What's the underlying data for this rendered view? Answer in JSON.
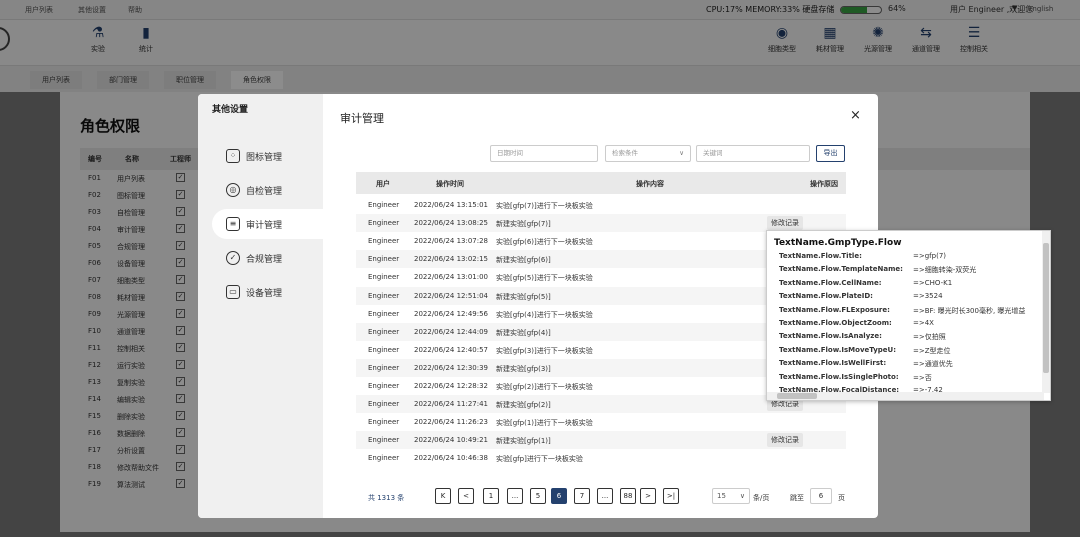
{
  "topbar": {
    "menu": [
      "用户列表",
      "其他设置",
      "帮助"
    ],
    "status": "CPU:17% MEMORY:33% 硬盘存储",
    "disk_fill": 0.64,
    "disk_pct": "64%",
    "user": "用户 Engineer ,欢迎您",
    "caret": "▼",
    "lang": "English"
  },
  "toolbar": {
    "left": [
      {
        "label": "实验",
        "icon": "flask-icon",
        "glyph": "⚗"
      },
      {
        "label": "统计",
        "icon": "bar-chart-icon",
        "glyph": "▮"
      }
    ],
    "right": [
      {
        "label": "细胞类型",
        "icon": "cell-icon",
        "glyph": "◉"
      },
      {
        "label": "耗材管理",
        "icon": "consumable-icon",
        "glyph": "▦"
      },
      {
        "label": "光源管理",
        "icon": "light-icon",
        "glyph": "✺"
      },
      {
        "label": "通道管理",
        "icon": "channel-icon",
        "glyph": "⇆"
      },
      {
        "label": "控制相关",
        "icon": "control-icon",
        "glyph": "☰"
      }
    ]
  },
  "bg_tabs": [
    "用户列表",
    "部门管理",
    "职位管理",
    "角色权限"
  ],
  "role": {
    "title": "角色权限",
    "headers": [
      "编号",
      "名称",
      "工程师"
    ],
    "rows": [
      {
        "id": "F01",
        "name": "用户列表"
      },
      {
        "id": "F02",
        "name": "图标管理"
      },
      {
        "id": "F03",
        "name": "自检管理"
      },
      {
        "id": "F04",
        "name": "审计管理"
      },
      {
        "id": "F05",
        "name": "合规管理"
      },
      {
        "id": "F06",
        "name": "设备管理"
      },
      {
        "id": "F07",
        "name": "细胞类型"
      },
      {
        "id": "F08",
        "name": "耗材管理"
      },
      {
        "id": "F09",
        "name": "光源管理"
      },
      {
        "id": "F10",
        "name": "通道管理"
      },
      {
        "id": "F11",
        "name": "控制相关"
      },
      {
        "id": "F12",
        "name": "运行实验"
      },
      {
        "id": "F13",
        "name": "复制实验"
      },
      {
        "id": "F14",
        "name": "编辑实验"
      },
      {
        "id": "F15",
        "name": "删除实验"
      },
      {
        "id": "F16",
        "name": "数据删除"
      },
      {
        "id": "F17",
        "name": "分析设置"
      },
      {
        "id": "F18",
        "name": "修改帮助文件"
      },
      {
        "id": "F19",
        "name": "算法测试"
      }
    ],
    "check": "✓"
  },
  "dialog": {
    "side_title": "其他设置",
    "side_items": [
      {
        "label": "图标管理",
        "icon": "icons-grid-icon",
        "glyph": "⁘"
      },
      {
        "label": "自检管理",
        "icon": "self-check-icon",
        "glyph": "◎"
      },
      {
        "label": "审计管理",
        "icon": "audit-list-icon",
        "glyph": "≡"
      },
      {
        "label": "合规管理",
        "icon": "compliance-check-icon",
        "glyph": "✓"
      },
      {
        "label": "设备管理",
        "icon": "device-icon",
        "glyph": "▭"
      }
    ],
    "title": "审计管理",
    "close": "×",
    "filters": {
      "date_placeholder": "日期时间",
      "condition_placeholder": "检索条件",
      "keyword_placeholder": "关键词",
      "export": "导出"
    },
    "columns": [
      "用户",
      "操作时间",
      "操作内容",
      "操作原因"
    ],
    "rows": [
      {
        "user": "Engineer",
        "time": "2022/06/24 13:15:01",
        "op": "实验[gfp(7)]进行下一块板实验",
        "rec": ""
      },
      {
        "user": "Engineer",
        "time": "2022/06/24 13:08:25",
        "op": "新建实验[gfp(7)]",
        "rec": "修改记录"
      },
      {
        "user": "Engineer",
        "time": "2022/06/24 13:07:28",
        "op": "实验[gfp(6)]进行下一块板实验",
        "rec": ""
      },
      {
        "user": "Engineer",
        "time": "2022/06/24 13:02:15",
        "op": "新建实验[gfp(6)]",
        "rec": ""
      },
      {
        "user": "Engineer",
        "time": "2022/06/24 13:01:00",
        "op": "实验[gfp(5)]进行下一块板实验",
        "rec": ""
      },
      {
        "user": "Engineer",
        "time": "2022/06/24 12:51:04",
        "op": "新建实验[gfp(5)]",
        "rec": ""
      },
      {
        "user": "Engineer",
        "time": "2022/06/24 12:49:56",
        "op": "实验[gfp(4)]进行下一块板实验",
        "rec": ""
      },
      {
        "user": "Engineer",
        "time": "2022/06/24 12:44:09",
        "op": "新建实验[gfp(4)]",
        "rec": ""
      },
      {
        "user": "Engineer",
        "time": "2022/06/24 12:40:57",
        "op": "实验[gfp(3)]进行下一块板实验",
        "rec": ""
      },
      {
        "user": "Engineer",
        "time": "2022/06/24 12:30:39",
        "op": "新建实验[gfp(3)]",
        "rec": ""
      },
      {
        "user": "Engineer",
        "time": "2022/06/24 12:28:32",
        "op": "实验[gfp(2)]进行下一块板实验",
        "rec": ""
      },
      {
        "user": "Engineer",
        "time": "2022/06/24 11:27:41",
        "op": "新建实验[gfp(2)]",
        "rec": "修改记录"
      },
      {
        "user": "Engineer",
        "time": "2022/06/24 11:26:23",
        "op": "实验[gfp(1)]进行下一块板实验",
        "rec": ""
      },
      {
        "user": "Engineer",
        "time": "2022/06/24 10:49:21",
        "op": "新建实验[gfp(1)]",
        "rec": "修改记录"
      },
      {
        "user": "Engineer",
        "time": "2022/06/24 10:46:38",
        "op": "实验[gfp]进行下一块板实验",
        "rec": ""
      }
    ],
    "pagination": {
      "total": "共 1313 条",
      "buttons": [
        "K",
        "<",
        "1",
        "...",
        "5",
        "6",
        "7",
        "...",
        "88",
        ">",
        ">|"
      ],
      "active": "6",
      "page_size": "15",
      "page_size_caret": "∨",
      "per_page": "条/页",
      "jump_label": "跳至",
      "jump_value": "6",
      "page_suffix": "页"
    }
  },
  "popup": {
    "title": "TextName.GmpType.Flow",
    "items": [
      {
        "k": "TextName.Flow.Title:",
        "v": "=>gfp(7)"
      },
      {
        "k": "TextName.Flow.TemplateName:",
        "v": "=>细胞转染-双荧光"
      },
      {
        "k": "TextName.Flow.CellName:",
        "v": "=>CHO-K1"
      },
      {
        "k": "TextName.Flow.PlateID:",
        "v": "=>3524"
      },
      {
        "k": "TextName.Flow.FLExposure:",
        "v": "=>BF: 曝光时长300毫秒, 曝光增益"
      },
      {
        "k": "TextName.Flow.ObjectZoom:",
        "v": "=>4X"
      },
      {
        "k": "TextName.Flow.IsAnalyze:",
        "v": "=>仅拍照"
      },
      {
        "k": "TextName.Flow.IsMoveTypeU:",
        "v": "=>Z型走位"
      },
      {
        "k": "TextName.Flow.IsWellFirst:",
        "v": "=>通道优先"
      },
      {
        "k": "TextName.Flow.IsSinglePhoto:",
        "v": "=>否"
      },
      {
        "k": "TextName.Flow.FocalDistance:",
        "v": "=>-7.42"
      }
    ]
  }
}
